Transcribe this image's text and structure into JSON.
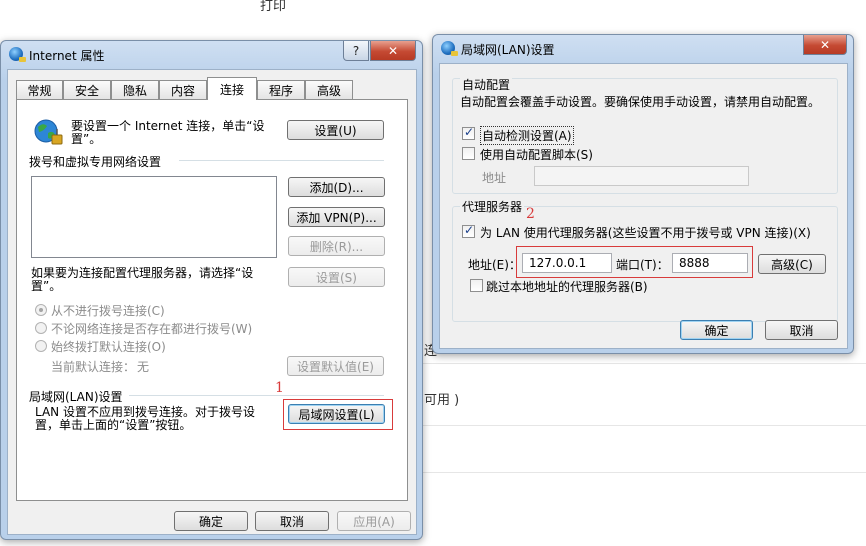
{
  "background": {
    "top_text": "打印",
    "mid_text_1": "连",
    "mid_text_2": "可用 )"
  },
  "inet": {
    "title": "Internet 属性",
    "help_btn": "?",
    "close_btn": "✕",
    "tabs": [
      "常规",
      "安全",
      "隐私",
      "内容",
      "连接",
      "程序",
      "高级"
    ],
    "active_tab": "连接",
    "setup_text": "要设置一个 Internet 连接，单击“设置”。",
    "setup_btn": "设置(U)",
    "dialup_header": "拨号和虚拟专用网络设置",
    "add_btn": "添加(D)...",
    "add_vpn_btn": "添加 VPN(P)...",
    "delete_btn": "删除(R)...",
    "proxy_text": "如果要为连接配置代理服务器，请选择“设置”。",
    "settings_btn": "设置(S)",
    "radio_never": "从不进行拨号连接(C)",
    "radio_when_no_net": "不论网络连接是否存在都进行拨号(W)",
    "radio_always": "始终拨打默认连接(O)",
    "current_default_label": "当前默认连接：",
    "current_default_value": "无",
    "set_default_btn": "设置默认值(E)",
    "lan_header": "局域网(LAN)设置",
    "lan_text": "LAN 设置不应用到拨号连接。对于拨号设置，单击上面的“设置”按钮。",
    "lan_btn": "局域网设置(L)",
    "annotation_1": "1",
    "ok_btn": "确定",
    "cancel_btn": "取消",
    "apply_btn": "应用(A)"
  },
  "lan": {
    "title": "局域网(LAN)设置",
    "close_btn": "✕",
    "auto_header": "自动配置",
    "auto_desc": "自动配置会覆盖手动设置。要确保使用手动设置，请禁用自动配置。",
    "auto_detect": "自动检测设置(A)",
    "auto_detect_checked": true,
    "auto_script": "使用自动配置脚本(S)",
    "auto_script_checked": false,
    "address_label": "地址",
    "proxy_header": "代理服务器",
    "annotation_2": "2",
    "use_proxy": "为 LAN 使用代理服务器(这些设置不用于拨号或 VPN 连接)(X)",
    "use_proxy_checked": true,
    "proxy_address_label": "地址(E)：",
    "proxy_address_value": "127.0.0.1",
    "port_label": "端口(T)：",
    "port_value": "8888",
    "advanced_btn": "高级(C)",
    "bypass_local": "跳过本地地址的代理服务器(B)",
    "bypass_local_checked": false,
    "ok_btn": "确定",
    "cancel_btn": "取消"
  }
}
